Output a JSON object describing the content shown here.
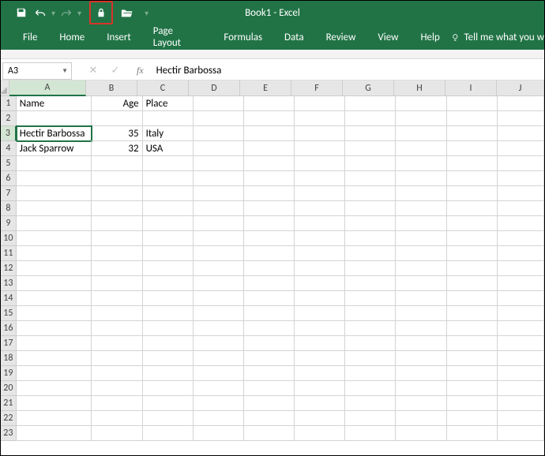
{
  "app": {
    "title": "Book1  -  Excel"
  },
  "tabs": {
    "file": "File",
    "home": "Home",
    "insert": "Insert",
    "pageLayout": "Page Layout",
    "formulas": "Formulas",
    "data": "Data",
    "review": "Review",
    "view": "View",
    "help": "Help",
    "tellMe": "Tell me what you w"
  },
  "namebox": {
    "value": "A3"
  },
  "fx": {
    "label": "fx",
    "value": "Hectir Barbossa"
  },
  "columns": [
    "A",
    "B",
    "C",
    "D",
    "E",
    "F",
    "G",
    "H",
    "I",
    "J"
  ],
  "rowNums": [
    "1",
    "2",
    "3",
    "4",
    "5",
    "6",
    "7",
    "8",
    "9",
    "10",
    "11",
    "12",
    "13",
    "14",
    "15",
    "16",
    "17",
    "18",
    "19",
    "20",
    "21",
    "22",
    "23"
  ],
  "cells": {
    "A1": "Name",
    "B1": "Age",
    "C1": "Place",
    "A3": "Hectir Barbossa",
    "B3": "35",
    "C3": "Italy",
    "A4": "Jack Sparrow",
    "B4": "32",
    "C4": "USA"
  },
  "active": {
    "cell": "A3",
    "col": "A",
    "row": "3"
  }
}
